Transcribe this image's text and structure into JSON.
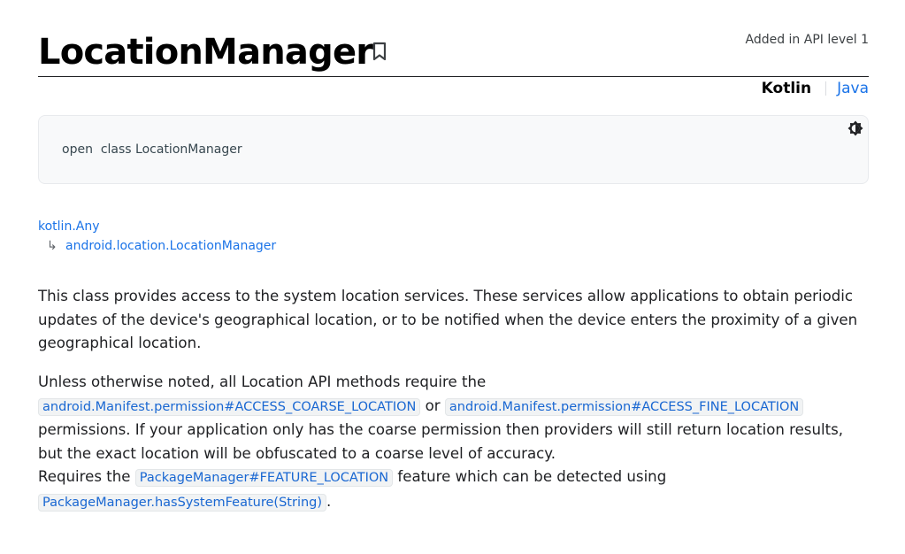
{
  "header": {
    "title": "LocationManager",
    "api_level": "Added in API level 1",
    "bookmark_icon": "bookmark-icon"
  },
  "language_switch": {
    "kotlin_label": "Kotlin",
    "java_label": "Java"
  },
  "signature": {
    "code": "open  class LocationManager",
    "theme_icon": "brightness-icon"
  },
  "hierarchy": {
    "parent": "kotlin.Any",
    "arrow": "↳",
    "child": "android.location.LocationManager"
  },
  "description": {
    "paragraph1": "This class provides access to the system location services. These services allow applications to obtain periodic updates of the device's geographical location, or to be notified when the device enters the proximity of a given geographical location.",
    "p2_intro": "Unless otherwise noted, all Location API methods require the",
    "p2_coarse_link": "android.Manifest.permission#ACCESS_COARSE_LOCATION",
    "p2_or": "or",
    "p2_fine_link": "android.Manifest.permission#ACCESS_FINE_LOCATION",
    "p2_rest": "permissions. If your application only has the coarse permission then providers will still return location results, but the exact location will be obfuscated to a coarse level of accuracy.",
    "p2_requires": "Requires the",
    "p2_feature_link": "PackageManager#FEATURE_LOCATION",
    "p2_feature_text": "feature which can be detected using",
    "p2_method_link": "PackageManager.hasSystemFeature(String)",
    "p2_period": "."
  },
  "colors": {
    "link": "#1a73e8",
    "code_link": "#1967d2",
    "text": "#202124"
  }
}
